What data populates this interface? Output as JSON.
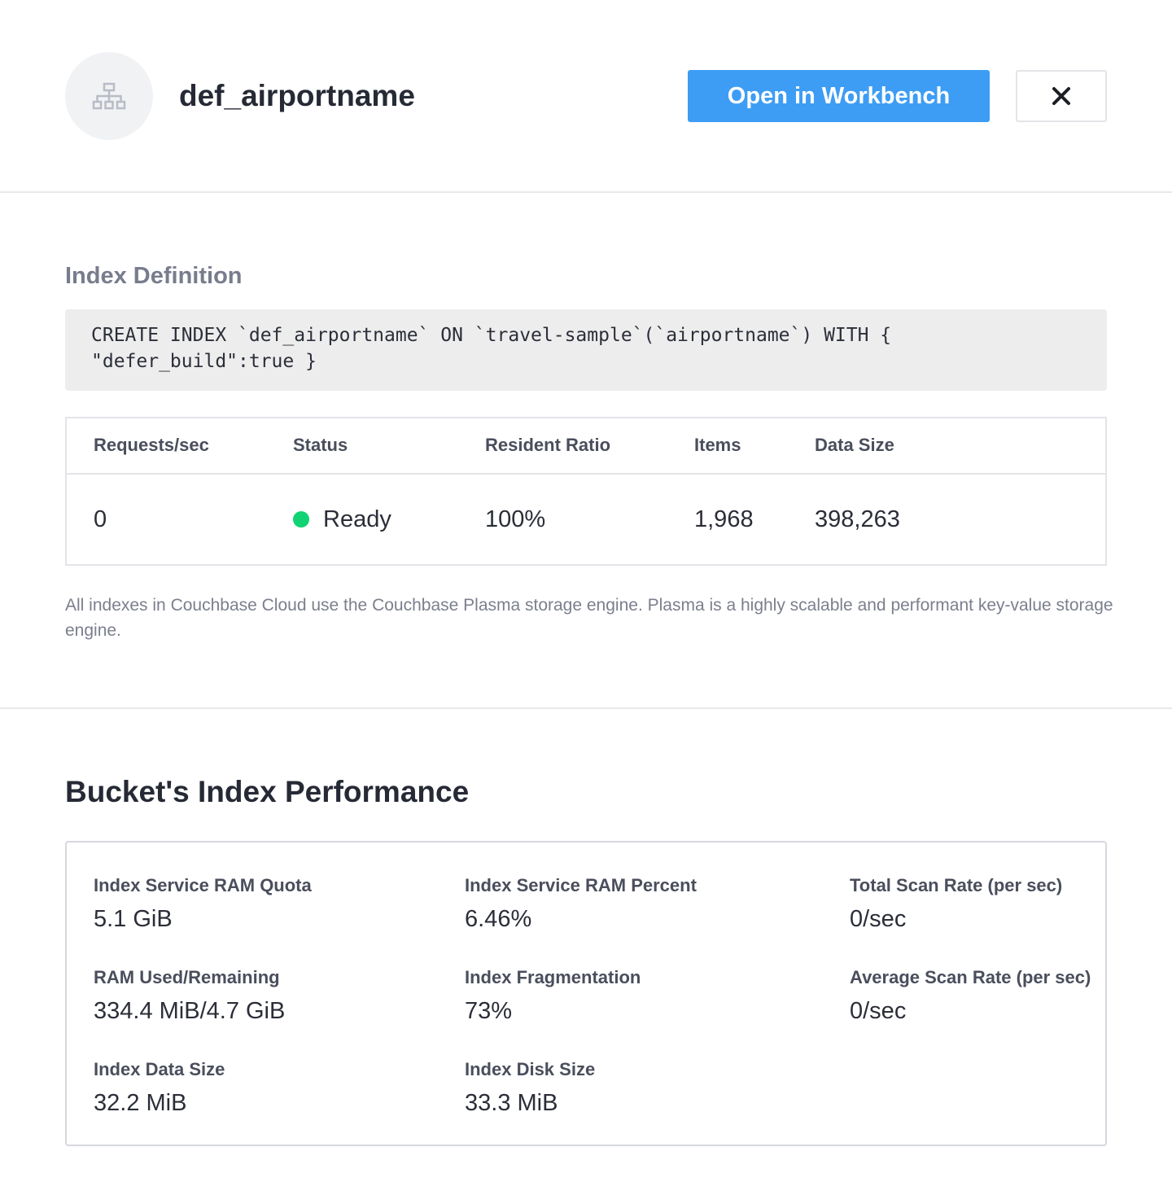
{
  "header": {
    "title": "def_airportname",
    "avatar_icon": "sitemap-icon",
    "open_button_label": "Open in Workbench",
    "close_icon": "close-icon",
    "primary_color": "#3d9df4"
  },
  "definition": {
    "heading": "Index Definition",
    "code": "CREATE INDEX `def_airportname` ON `travel-sample`(`airportname`) WITH {\n\"defer_build\":true }"
  },
  "stats": {
    "columns": [
      "Requests/sec",
      "Status",
      "Resident Ratio",
      "Items",
      "Data Size"
    ],
    "row": {
      "requests": "0",
      "status": "Ready",
      "status_color": "#11d373",
      "resident_ratio": "100%",
      "items": "1,968",
      "data_size": "398,263"
    }
  },
  "note": "All indexes in Couchbase Cloud use the Couchbase Plasma storage engine. Plasma is a highly scalable and performant key-value storage engine.",
  "performance": {
    "title": "Bucket's Index Performance",
    "metrics": [
      {
        "label": "Index Service RAM Quota",
        "value": "5.1 GiB"
      },
      {
        "label": "Index Service RAM Percent",
        "value": "6.46%"
      },
      {
        "label": "Total Scan Rate (per sec)",
        "value": "0/sec"
      },
      {
        "label": "RAM Used/Remaining",
        "value": "334.4 MiB/4.7 GiB"
      },
      {
        "label": "Index Fragmentation",
        "value": "73%"
      },
      {
        "label": "Average Scan Rate (per sec)",
        "value": "0/sec"
      },
      {
        "label": "Index Data Size",
        "value": "32.2 MiB"
      },
      {
        "label": "Index Disk Size",
        "value": "33.3 MiB"
      }
    ]
  }
}
